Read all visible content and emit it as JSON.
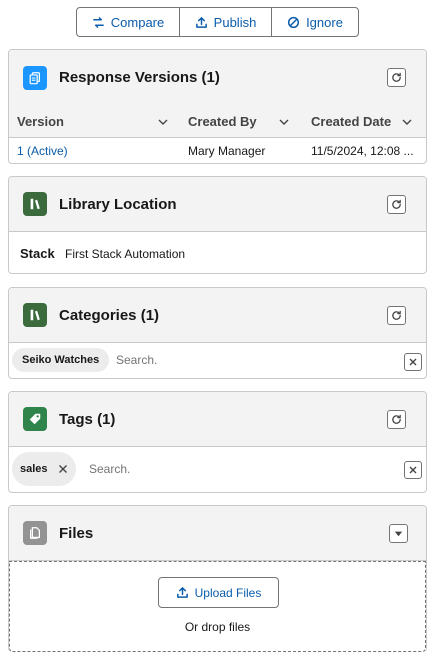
{
  "actions": {
    "compare": "Compare",
    "publish": "Publish",
    "ignore": "Ignore"
  },
  "response_versions": {
    "title": "Response Versions (1)",
    "columns": [
      "Version",
      "Created By",
      "Created Date"
    ],
    "rows": [
      {
        "version": "1 (Active)",
        "created_by": "Mary Manager",
        "created_date": "11/5/2024, 12:08 ..."
      }
    ]
  },
  "library_location": {
    "title": "Library Location",
    "field_label": "Stack",
    "field_value": "First Stack Automation"
  },
  "categories": {
    "title": "Categories (1)",
    "pill": "Seiko Watches",
    "search_placeholder": "Search."
  },
  "tags": {
    "title": "Tags (1)",
    "pill": "sales",
    "search_placeholder": "Search."
  },
  "files": {
    "title": "Files",
    "upload_label": "Upload Files",
    "drop_text": "Or drop files"
  },
  "colors": {
    "link": "#0b5cab",
    "versions_icon": "#1b96ff",
    "library_icon": "#3b6b3c",
    "tags_icon": "#2e844a",
    "files_icon": "#939393"
  }
}
